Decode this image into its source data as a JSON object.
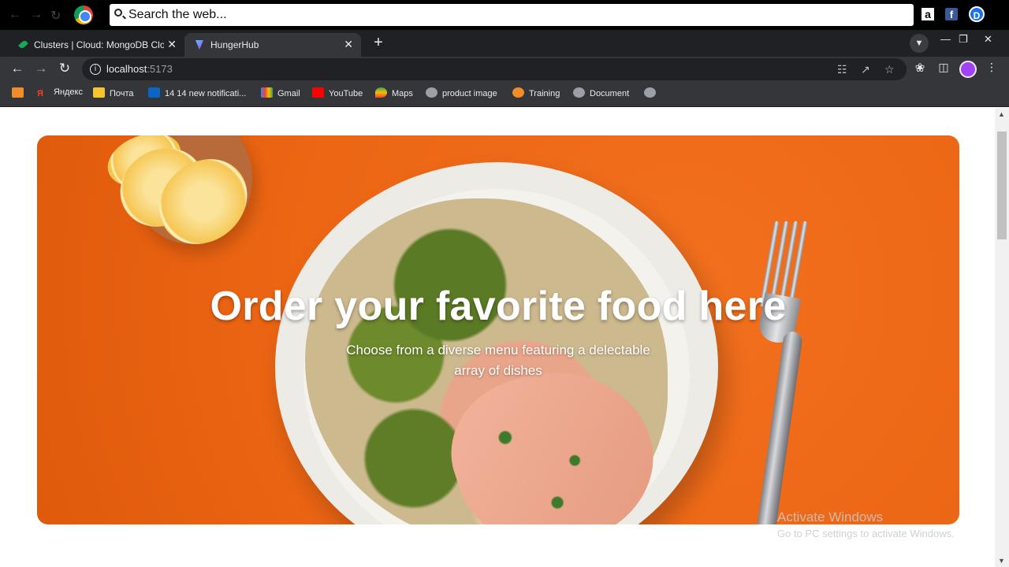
{
  "websearch": {
    "placeholder": "Search the web..."
  },
  "extensions": {
    "amazon": "a",
    "facebook": "f",
    "d": "D"
  },
  "tabs": [
    {
      "label": "Clusters | Cloud: MongoDB Cloud",
      "icon": "mongodb-leaf-icon",
      "active": false
    },
    {
      "label": "HungerHub",
      "icon": "vite-icon",
      "active": true
    }
  ],
  "address": {
    "host": "localhost",
    "port": ":5173"
  },
  "bookmarks": [
    {
      "label": "",
      "icon": "swiggy-icon"
    },
    {
      "label": "Яндекс",
      "icon": "yandex-icon"
    },
    {
      "label": "Почта",
      "icon": "mail-icon"
    },
    {
      "label": "14 14 new notificati...",
      "icon": "linkedin-icon"
    },
    {
      "label": "Gmail",
      "icon": "gmail-icon"
    },
    {
      "label": "YouTube",
      "icon": "youtube-icon"
    },
    {
      "label": "Maps",
      "icon": "maps-icon"
    },
    {
      "label": "product image",
      "icon": "globe-icon"
    },
    {
      "label": "Training",
      "icon": "training-icon"
    },
    {
      "label": "Document",
      "icon": "globe-icon"
    },
    {
      "label": "",
      "icon": "globe-icon"
    }
  ],
  "hero": {
    "title": "Order your favorite food here",
    "subtitle": "Choose from a diverse menu featuring a delectable array of dishes"
  },
  "watermark": {
    "line1": "Activate Windows",
    "line2": "Go to PC settings to activate Windows."
  },
  "colors": {
    "hero_orange": "#ec6614",
    "tab_active": "#35363a",
    "chrome_dark": "#202124"
  }
}
